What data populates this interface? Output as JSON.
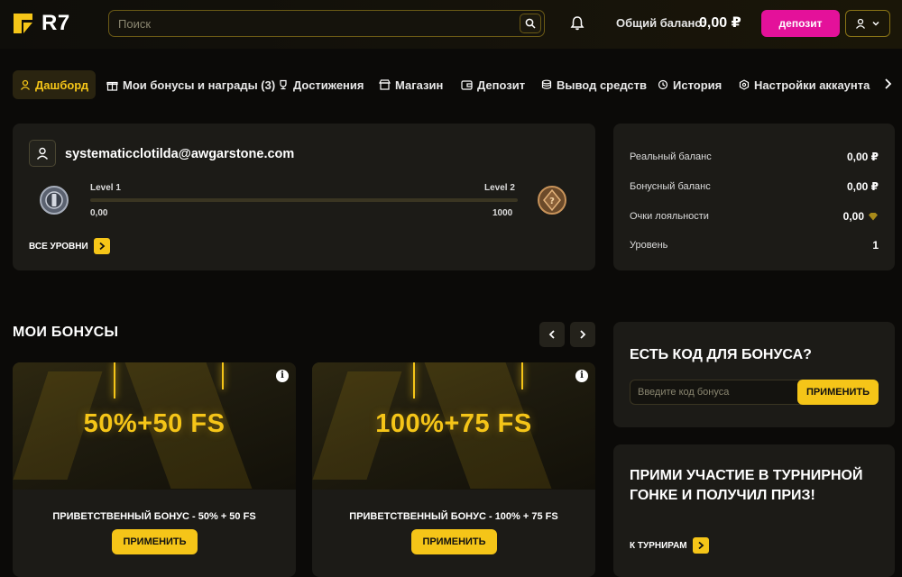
{
  "header": {
    "logo_text": "R7",
    "search_placeholder": "Поиск",
    "balance_label": "Общий баланс:",
    "balance_value": "0,00 ₽",
    "deposit_label": "депозит"
  },
  "tabs": [
    {
      "label": "Дашборд",
      "icon": "user-icon",
      "active": true
    },
    {
      "label": "Мои бонусы и награды (3)",
      "icon": "gift-icon"
    },
    {
      "label": "Достижения",
      "icon": "trophy-icon"
    },
    {
      "label": "Магазин",
      "icon": "store-icon"
    },
    {
      "label": "Депозит",
      "icon": "wallet-icon"
    },
    {
      "label": "Вывод средств",
      "icon": "coins-icon"
    },
    {
      "label": "История",
      "icon": "history-icon"
    },
    {
      "label": "Настройки аккаунта",
      "icon": "settings-icon"
    }
  ],
  "profile": {
    "email": "systematicclotilda@awgarstone.com",
    "level_current": "Level 1",
    "level_next": "Level 2",
    "points_current": "0,00",
    "points_target": "1000",
    "progress_fraction": 0.0,
    "all_levels_label": "ВСЕ УРОВНИ"
  },
  "stats": [
    {
      "label": "Реальный баланс",
      "value": "0,00 ₽"
    },
    {
      "label": "Бонусный баланс",
      "value": "0,00 ₽"
    },
    {
      "label": "Очки лояльности",
      "value": "0,00"
    },
    {
      "label": "Уровень",
      "value": "1"
    }
  ],
  "bonuses": {
    "title": "МОИ БОНУСЫ",
    "cards": [
      {
        "headline": "50%+50 FS",
        "name": "ПРИВЕТСТВЕННЫЙ БОНУС - 50% + 50 FS",
        "button": "ПРИМЕНИТЬ"
      },
      {
        "headline": "100%+75 FS",
        "name": "ПРИВЕТСТВЕННЫЙ БОНУС - 100% + 75 FS",
        "button": "ПРИМЕНИТЬ"
      }
    ]
  },
  "promo": {
    "title": "ЕСТЬ КОД ДЛЯ БОНУСА?",
    "placeholder": "Введите код бонуса",
    "button": "ПРИМЕНИТЬ"
  },
  "tournament": {
    "title": "ПРИМИ УЧАСТИЕ В ТУРНИРНОЙ ГОНКЕ И ПОЛУЧИЛ ПРИЗ!",
    "link": "К ТУРНИРАМ"
  },
  "colors": {
    "accent": "#f5c518",
    "deposit": "#e4119a",
    "panel": "#1c1b17",
    "background": "#0b0a08"
  }
}
